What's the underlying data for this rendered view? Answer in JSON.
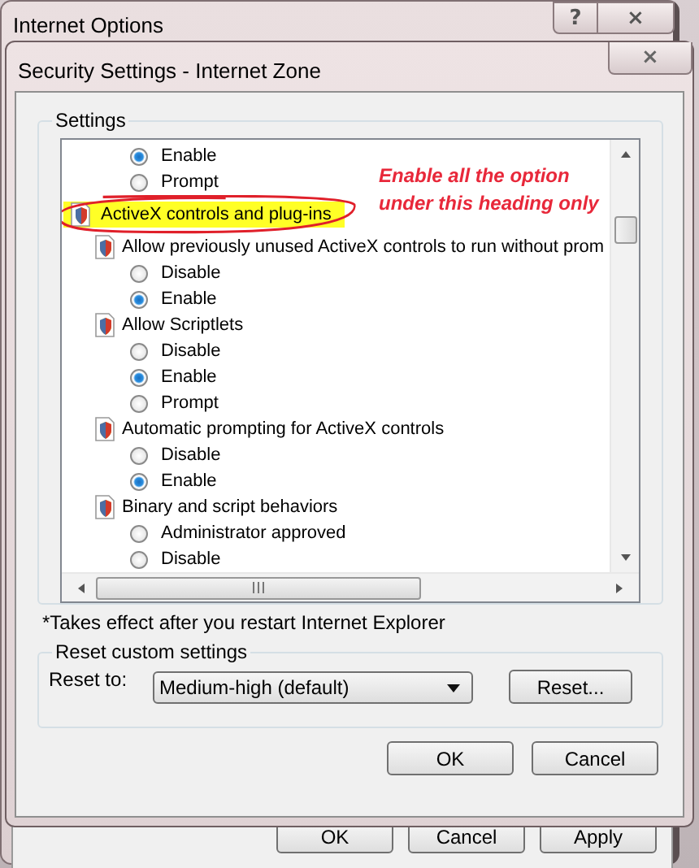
{
  "outer_window": {
    "title": "Internet Options",
    "title_buttons": [
      "?",
      "×"
    ],
    "buttons": [
      "OK",
      "Cancel",
      "Apply"
    ]
  },
  "dialog": {
    "title": "Security Settings - Internet Zone",
    "close_button": "×",
    "settings_group": {
      "label": "Settings",
      "items": [
        {
          "kind": "option",
          "label": "Enable",
          "selected": true
        },
        {
          "kind": "option",
          "label": "Prompt",
          "selected": false
        },
        {
          "kind": "category",
          "label": "ActiveX controls and plug-ins",
          "highlighted": true,
          "children": [
            {
              "kind": "setting",
              "label": "Allow previously unused ActiveX controls to run without prom",
              "children": [
                {
                  "kind": "option",
                  "label": "Disable",
                  "selected": false
                },
                {
                  "kind": "option",
                  "label": "Enable",
                  "selected": true
                }
              ]
            },
            {
              "kind": "setting",
              "label": "Allow Scriptlets",
              "children": [
                {
                  "kind": "option",
                  "label": "Disable",
                  "selected": false
                },
                {
                  "kind": "option",
                  "label": "Enable",
                  "selected": true
                },
                {
                  "kind": "option",
                  "label": "Prompt",
                  "selected": false
                }
              ]
            },
            {
              "kind": "setting",
              "label": "Automatic prompting for ActiveX controls",
              "children": [
                {
                  "kind": "option",
                  "label": "Disable",
                  "selected": false
                },
                {
                  "kind": "option",
                  "label": "Enable",
                  "selected": true
                }
              ]
            },
            {
              "kind": "setting",
              "label": "Binary and script behaviors",
              "children": [
                {
                  "kind": "option",
                  "label": "Administrator approved",
                  "selected": false
                },
                {
                  "kind": "option",
                  "label": "Disable",
                  "selected": false
                }
              ]
            }
          ]
        }
      ],
      "note": "*Takes effect after you restart Internet Explorer"
    },
    "reset_group": {
      "label": "Reset custom settings",
      "reset_to_label": "Reset to:",
      "reset_to_value": "Medium-high (default)",
      "reset_button": "Reset..."
    },
    "buttons": [
      "OK",
      "Cancel"
    ]
  },
  "annotation": {
    "text": "Enable all the option under this heading only"
  }
}
